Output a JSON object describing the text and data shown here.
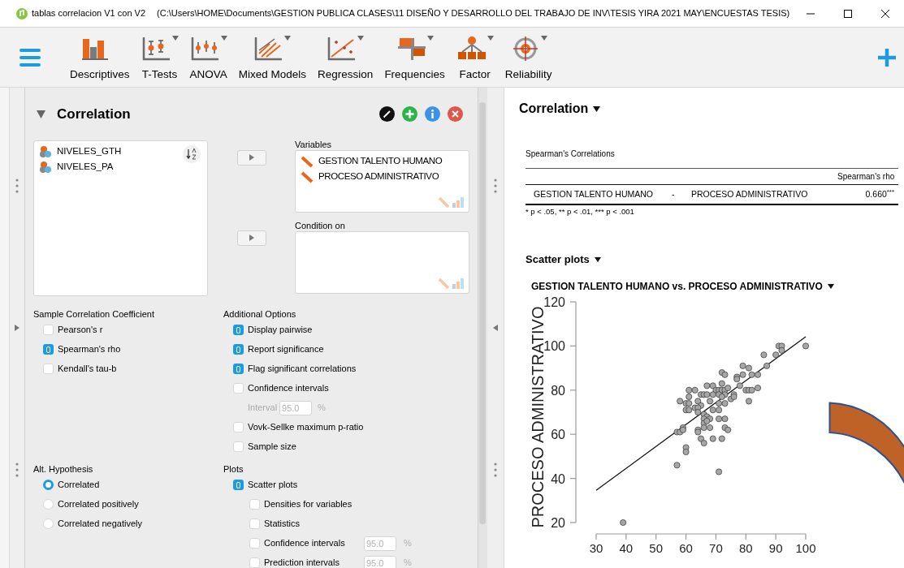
{
  "window": {
    "title": "tablas correlacion V1 con V2",
    "path": "(C:\\Users\\HOME\\Documents\\GESTION PUBLICA CLASES\\11 DISEÑO Y DESARROLLO DEL TRABAJO DE INV\\TESIS YIRA 2021 MAY\\ENCUESTAS TESIS)"
  },
  "toolbar": [
    {
      "label": "Descriptives",
      "has_menu": false
    },
    {
      "label": "T-Tests",
      "has_menu": true
    },
    {
      "label": "ANOVA",
      "has_menu": true
    },
    {
      "label": "Mixed Models",
      "has_menu": true
    },
    {
      "label": "Regression",
      "has_menu": true
    },
    {
      "label": "Frequencies",
      "has_menu": true
    },
    {
      "label": "Factor",
      "has_menu": true
    },
    {
      "label": "Reliability",
      "has_menu": true
    }
  ],
  "analysis": {
    "title": "Correlation",
    "expanded": true,
    "source_variables": [
      "NIVELES_GTH",
      "NIVELES_PA"
    ],
    "variables_label": "Variables",
    "variables": [
      "GESTION TALENTO HUMANO",
      "PROCESO ADMINISTRATIVO"
    ],
    "condition_label": "Condition on",
    "sample_coefficient_label": "Sample Correlation Coefficient",
    "sample_coefficient": [
      {
        "label": "Pearson's r",
        "checked": false
      },
      {
        "label": "Spearman's rho",
        "checked": true
      },
      {
        "label": "Kendall's tau-b",
        "checked": false
      }
    ],
    "additional_options_label": "Additional Options",
    "additional_options": [
      {
        "kind": "checkbox",
        "label": "Display pairwise",
        "checked": true
      },
      {
        "kind": "checkbox",
        "label": "Report significance",
        "checked": true
      },
      {
        "kind": "checkbox",
        "label": "Flag significant correlations",
        "checked": true
      },
      {
        "kind": "checkbox",
        "label": "Confidence intervals",
        "checked": false
      },
      {
        "kind": "field",
        "label": "Interval",
        "value": "95.0",
        "unit": "%",
        "disabled": true
      },
      {
        "kind": "checkbox",
        "label": "Vovk-Sellke maximum p-ratio",
        "checked": false
      },
      {
        "kind": "checkbox",
        "label": "Sample size",
        "checked": false
      }
    ],
    "alt_hypothesis_label": "Alt. Hypothesis",
    "alt_hypothesis": [
      {
        "label": "Correlated",
        "selected": true
      },
      {
        "label": "Correlated positively",
        "selected": false
      },
      {
        "label": "Correlated negatively",
        "selected": false
      }
    ],
    "plots_label": "Plots",
    "plots": [
      {
        "label": "Scatter plots",
        "checked": true,
        "children": [
          {
            "label": "Densities for variables",
            "checked": false
          },
          {
            "label": "Statistics",
            "checked": false
          },
          {
            "label": "Confidence intervals",
            "checked": false,
            "field": {
              "value": "95.0",
              "unit": "%",
              "disabled": true
            }
          },
          {
            "label": "Prediction intervals",
            "checked": false,
            "field": {
              "value": "95.0",
              "unit": "%",
              "disabled": true
            }
          }
        ]
      }
    ]
  },
  "results": {
    "title": "Correlation",
    "table": {
      "title": "Spearman's Correlations",
      "columns": [
        "",
        "",
        "",
        "Spearman's rho"
      ],
      "rows": [
        [
          "GESTION TALENTO HUMANO",
          "-",
          "PROCESO ADMINISTRATIVO",
          "0.660$^{***}$"
        ]
      ],
      "footnote": "* p < .05, ** p < .01, *** p < .001"
    },
    "scatter_title": "Scatter plots",
    "plot_title": "GESTION TALENTO HUMANO vs. PROCESO ADMINISTRATIVO",
    "chart_data": {
      "type": "scatter",
      "ylabel": "PROCESO ADMINISTRATIVO",
      "xlim": [
        30,
        100
      ],
      "ylim": [
        20,
        120
      ],
      "xticks": [
        30,
        40,
        50,
        60,
        70,
        80,
        90,
        100
      ],
      "yticks": [
        20,
        40,
        60,
        80,
        100,
        120
      ],
      "x": [
        100,
        91,
        92,
        92,
        90,
        86,
        87,
        79,
        81,
        82,
        84,
        79,
        77,
        77,
        78,
        72,
        73,
        72,
        67,
        69,
        80,
        81,
        82,
        84,
        81,
        61,
        63,
        70,
        71,
        72,
        73,
        74,
        76,
        75,
        76,
        65,
        66,
        67,
        69,
        71,
        73,
        61,
        72,
        68,
        73,
        71,
        58,
        60,
        61,
        64,
        65,
        63,
        64,
        60,
        61,
        69,
        71,
        64,
        66,
        67,
        68,
        71,
        73,
        66,
        66,
        67,
        66,
        68,
        73,
        74,
        64,
        64,
        59,
        57,
        58,
        59,
        65,
        69,
        72,
        66,
        60,
        60,
        57,
        71,
        39,
        30,
        100
      ],
      "series": [
        {
          "type": "line",
          "color": "#111111",
          "values": [
            null,
            null,
            null,
            null,
            null,
            null,
            null,
            null,
            null,
            null,
            null,
            null,
            null,
            null,
            null,
            null,
            null,
            null,
            null,
            null,
            null,
            null,
            null,
            null,
            null,
            null,
            null,
            null,
            null,
            null,
            null,
            null,
            null,
            null,
            null,
            null,
            null,
            null,
            null,
            null,
            null,
            null,
            null,
            null,
            null,
            null,
            null,
            null,
            null,
            null,
            null,
            null,
            null,
            null,
            null,
            null,
            null,
            null,
            null,
            null,
            null,
            null,
            null,
            null,
            null,
            null,
            null,
            null,
            null,
            null,
            null,
            null,
            null,
            null,
            null,
            null,
            null,
            null,
            null,
            null,
            null,
            null,
            null,
            null,
            null,
            34.6,
            104.2
          ]
        },
        {
          "color": "#a6a6a6",
          "values": [
            100,
            100,
            100,
            98,
            96,
            96,
            91,
            91,
            90,
            87,
            87,
            87,
            86,
            85,
            82,
            88,
            87,
            83,
            82,
            82,
            80,
            80,
            80,
            81,
            75,
            80,
            80,
            80,
            80,
            80,
            80,
            81,
            78,
            76,
            77,
            78,
            78,
            78,
            78,
            78,
            78,
            77,
            77,
            75,
            74,
            74,
            75,
            74,
            74,
            75,
            73,
            72,
            72,
            71,
            71,
            71,
            71,
            70,
            69,
            68,
            67,
            67,
            67,
            67,
            65,
            66,
            63,
            63,
            63,
            62,
            62,
            61,
            63,
            61,
            61,
            62,
            58,
            58,
            58,
            56,
            54,
            52,
            46,
            43,
            20,
            null,
            null
          ]
        }
      ]
    }
  }
}
